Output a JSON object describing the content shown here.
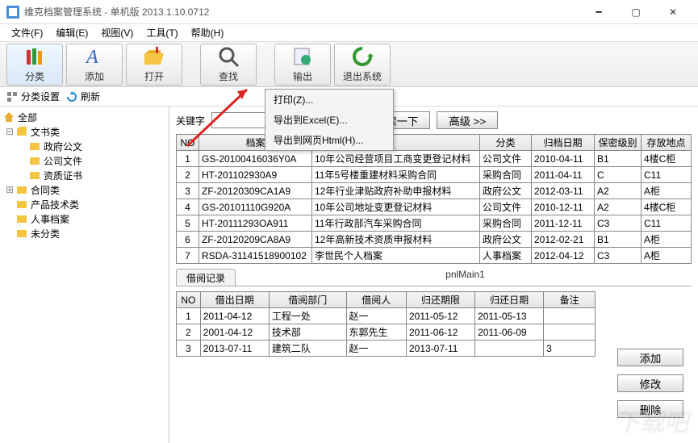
{
  "window": {
    "title": "维克档案管理系统 - 单机版 2013.1.10.0712"
  },
  "menus": [
    "文件(F)",
    "编辑(E)",
    "视图(V)",
    "工具(T)",
    "帮助(H)"
  ],
  "toolbar": [
    "分类",
    "添加",
    "打开",
    "查找",
    "输出",
    "退出系统"
  ],
  "subbar": {
    "cat_setup": "分类设置",
    "refresh": "刷新"
  },
  "tree": {
    "root": "全部",
    "docs": "文书类",
    "docs_children": [
      "政府公文",
      "公司文件",
      "资质证书"
    ],
    "contracts": "合同类",
    "product": "产品技术类",
    "hr": "人事档案",
    "uncat": "未分类"
  },
  "search": {
    "label": "关键字",
    "placeholder": "",
    "btn_search": "搜索一下",
    "btn_adv": "高级 >>"
  },
  "main_table": {
    "headers": [
      "NO",
      "档案",
      "",
      "分类",
      "归档日期",
      "保密级别",
      "存放地点"
    ],
    "rows": [
      {
        "no": "1",
        "code": "GS-20100416036Y0A",
        "desc": "10年公司经营项目工商变更登记材料",
        "cat": "公司文件",
        "date": "2010-04-11",
        "lvl": "B1",
        "loc": "4楼C柜"
      },
      {
        "no": "2",
        "code": "HT-201102930A9",
        "desc": "11年5号楼重建材料采购合同",
        "cat": "采购合同",
        "date": "2011-04-11",
        "lvl": "C",
        "loc": "C11"
      },
      {
        "no": "3",
        "code": "ZF-20120309CA1A9",
        "desc": "12年行业津贴政府补助申报材料",
        "cat": "政府公文",
        "date": "2012-03-11",
        "lvl": "A2",
        "loc": "A柜"
      },
      {
        "no": "4",
        "code": "GS-20101110G920A",
        "desc": "10年公司地址变更登记材料",
        "cat": "公司文件",
        "date": "2010-12-11",
        "lvl": "A2",
        "loc": "4楼C柜"
      },
      {
        "no": "5",
        "code": "HT-20111293OA911",
        "desc": "11年行政部汽车采购合同",
        "cat": "采购合同",
        "date": "2011-12-11",
        "lvl": "C3",
        "loc": "C11"
      },
      {
        "no": "6",
        "code": "ZF-20120209CA8A9",
        "desc": "12年高新技术资质申报材料",
        "cat": "政府公文",
        "date": "2012-02-21",
        "lvl": "B1",
        "loc": "A柜"
      },
      {
        "no": "7",
        "code": "RSDA-31141518900102",
        "desc": "李世民个人档案",
        "cat": "人事档案",
        "date": "2012-04-12",
        "lvl": "C3",
        "loc": "A柜"
      }
    ]
  },
  "tabs": {
    "borrow": "借阅记录",
    "pnl": "pnlMain1"
  },
  "borrow_table": {
    "headers": [
      "NO",
      "借出日期",
      "借阅部门",
      "借阅人",
      "归还期限",
      "归还日期",
      "备注"
    ],
    "rows": [
      {
        "no": "1",
        "d1": "2011-04-12",
        "dept": "工程一处",
        "who": "赵一",
        "due": "2011-05-12",
        "ret": "2011-05-13",
        "rem": ""
      },
      {
        "no": "2",
        "d1": "2001-04-12",
        "dept": "技术部",
        "who": "东郭先生",
        "due": "2011-06-12",
        "ret": "2011-06-09",
        "rem": ""
      },
      {
        "no": "3",
        "d1": "2013-07-11",
        "dept": "建筑二队",
        "who": "赵一",
        "due": "2013-07-11",
        "ret": "",
        "rem": "3"
      }
    ]
  },
  "side_buttons": {
    "add": "添加",
    "edit": "修改",
    "del": "删除"
  },
  "dropdown": {
    "print": "打印(Z)...",
    "excel": "导出到Excel(E)...",
    "html": "导出到网页Html(H)..."
  },
  "watermark": "下载吧"
}
